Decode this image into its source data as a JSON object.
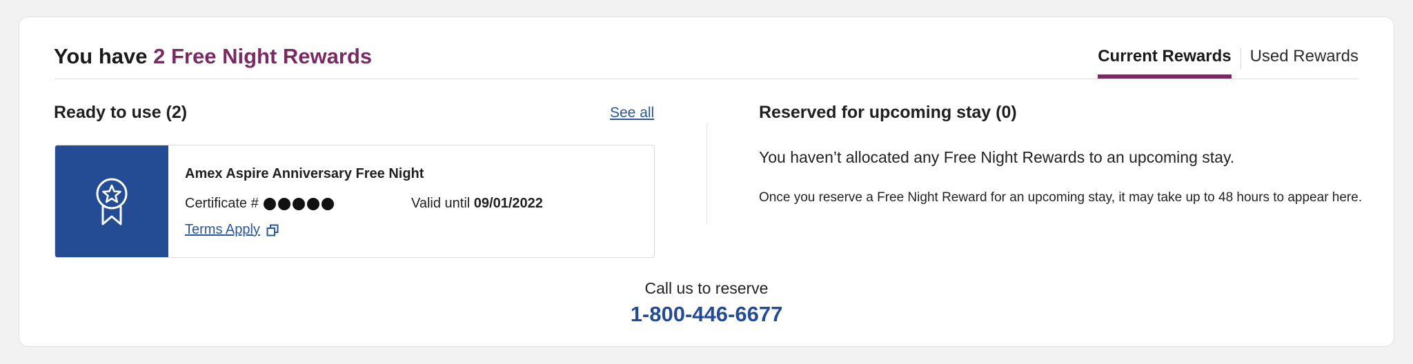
{
  "header": {
    "title_prefix": "You have ",
    "title_highlight": "2 Free Night Rewards"
  },
  "tabs": [
    {
      "label": "Current Rewards",
      "active": true
    },
    {
      "label": "Used Rewards",
      "active": false
    }
  ],
  "ready": {
    "title": "Ready to use (2)",
    "see_all_label": "See all",
    "certificate": {
      "name": "Amex Aspire Anniversary Free Night",
      "certificate_label": "Certificate #",
      "masked_digits": 5,
      "valid_label": "Valid until",
      "valid_date": "09/01/2022",
      "terms_label": "Terms Apply",
      "icon": "award-ribbon-star-icon",
      "badge_color": "#234c94"
    }
  },
  "reserved": {
    "title": "Reserved for upcoming stay (0)",
    "message": "You haven’t allocated any Free Night Rewards to an upcoming stay.",
    "note": "Once you reserve a Free Night Reward for an upcoming stay, it may take up to 48 hours to appear here."
  },
  "contact": {
    "label": "Call us to reserve",
    "phone": "1-800-446-6677"
  },
  "colors": {
    "accent": "#7a2a62",
    "link": "#2a5597",
    "brand_blue": "#234c94"
  }
}
